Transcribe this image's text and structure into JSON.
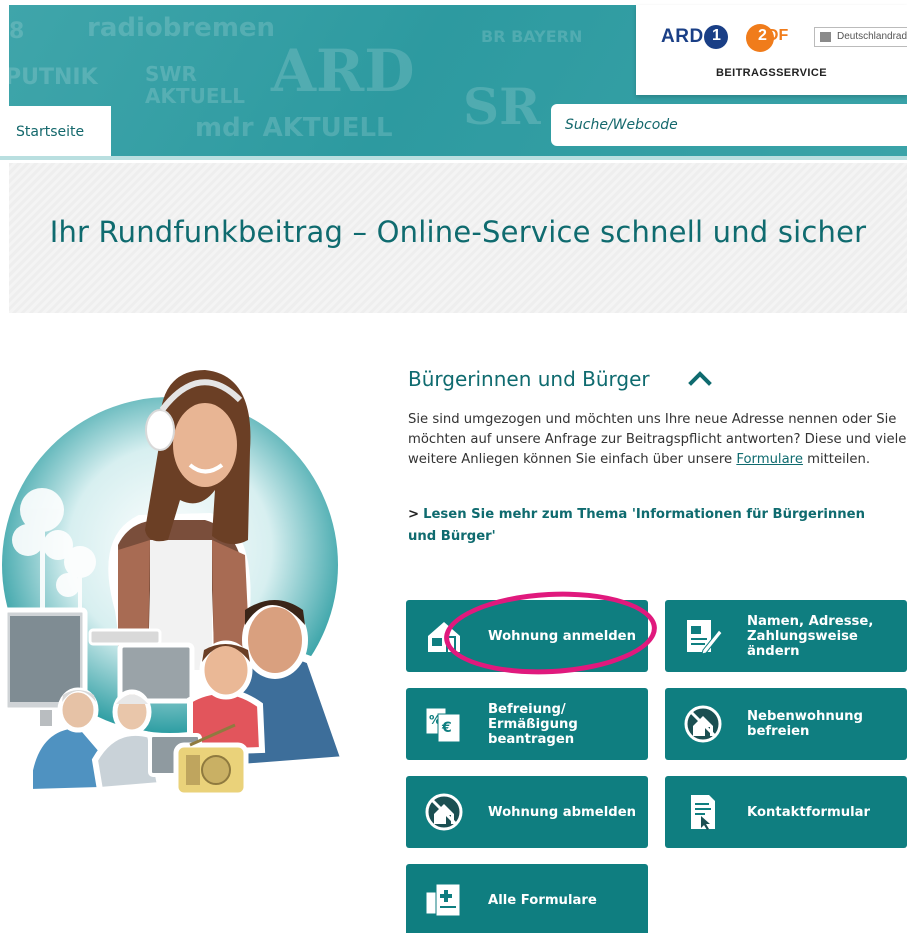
{
  "header": {
    "watermark_logos": [
      "8",
      "radiobremen",
      "SWR AKTUELL",
      "ARD",
      "BR BAYERN",
      "PUTNIK",
      "mdr AKTUELL",
      "SR"
    ],
    "brand": {
      "ard": "ARD",
      "zdf_prefix": "2",
      "zdf_suffix": "DF",
      "deutschlandradio": "Deutschlandradio",
      "service": "BEITRAGSSERVICE"
    },
    "nav_tab": "Startseite",
    "search_placeholder": "Suche/Webcode"
  },
  "hero": {
    "title": "Ihr Rundfunkbeitrag – Online-Service schnell und sicher"
  },
  "section": {
    "title": "Bürgerinnen und Bürger",
    "intro_before_link": "Sie sind umgezogen und möchten uns Ihre neue Adresse nennen oder Sie möchten auf unsere Anfrage zur Beitragspflicht antworten? Diese und viele weitere Anliegen können Sie einfach über unsere ",
    "intro_link": "Formulare",
    "intro_after_link": " mitteilen.",
    "more_arrow": ">",
    "more_link": "Lesen Sie mehr zum Thema 'Informationen für Bürgerinnen und Bürger'"
  },
  "tiles": [
    {
      "label": "Wohnung anmelden",
      "icon": "house-register-icon"
    },
    {
      "label": "Namen, Adresse, Zahlungsweise ändern",
      "icon": "document-edit-icon"
    },
    {
      "label": "Befreiung/ Ermäßigung beantragen",
      "icon": "exemption-documents-icon"
    },
    {
      "label": "Nebenwohnung befreien",
      "icon": "secondary-home-exempt-icon"
    },
    {
      "label": "Wohnung abmelden",
      "icon": "house-deregister-icon"
    },
    {
      "label": "Kontaktformular",
      "icon": "contact-form-icon"
    },
    {
      "label": "Alle Formulare",
      "icon": "all-forms-icon"
    }
  ],
  "colors": {
    "teal_banner": "#2d9aa0",
    "teal_text": "#0f6b6f",
    "tile_bg": "#0f7e80",
    "highlight_ellipse": "#e0197d",
    "ard_blue": "#1a3f86",
    "zdf_orange": "#f07c1b"
  }
}
